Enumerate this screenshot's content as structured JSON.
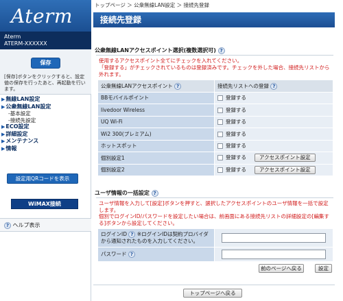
{
  "logo": "Aterm",
  "model": {
    "line1": "Aterm",
    "line2": "ATERM-XXXXXX"
  },
  "save": {
    "label": "保存",
    "note": "[保存]ボタンをクリックすると、設定値の保存を行ったあと、再起動を行います。"
  },
  "nav": {
    "items": [
      {
        "label": "無線LAN設定"
      },
      {
        "label": "公衆無線LAN設定",
        "subs": [
          "基本設定",
          "接続先設定"
        ]
      },
      {
        "label": "ECO設定"
      },
      {
        "label": "詳細設定"
      },
      {
        "label": "メンテナンス"
      },
      {
        "label": "情報"
      }
    ]
  },
  "qr_button": "設定用QRコードを表示",
  "wimax_button": "WiMAX接続",
  "help": "ヘルプ表示",
  "breadcrumb": "トップページ ＞ 公衆無線LAN設定 ＞ 接続先登録",
  "title": "接続先登録",
  "section1": {
    "heading": "公衆無線LANアクセスポイント選択(複数選択可)",
    "note1": "使用するアクセスポイント全てにチェックを入れてください。",
    "note2": "「登録する」がチェックされているものは登録済みです。チェックを外した場合、接続先リストから外れます。",
    "col_ap": "公衆無線LANアクセスポイント",
    "col_reg": "接続先リストへの登録",
    "register_label": "登録する",
    "ap_setting_button": "アクセスポイント設定",
    "rows": [
      {
        "name": "BBモバイルポイント"
      },
      {
        "name": "livedoor Wireless"
      },
      {
        "name": "UQ Wi-Fi"
      },
      {
        "name": "Wi2 300(プレミアム)"
      },
      {
        "name": "ホットスポット"
      },
      {
        "name": "個別設定1"
      },
      {
        "name": "個別設定2"
      }
    ]
  },
  "section2": {
    "heading": "ユーザ情報の一括設定",
    "note1": "ユーザ情報を入力して[設定]ボタンを押すと、選択したアクセスポイントのユーザ情報を一括で設定します。",
    "note2": "個別でログインID/パスワードを設定したい場合は、前画面にある接続先リストの詳細設定の[編集する]ボタンから設定してください。",
    "login_label": "ログインID",
    "login_note": "※ログインIDは契約プロバイダから通知されたものを入力してください。",
    "password_label": "パスワード",
    "login_value": "",
    "password_value": ""
  },
  "buttons": {
    "back": "前のページへ戻る",
    "set": "設定",
    "top": "トップページへ戻る"
  }
}
